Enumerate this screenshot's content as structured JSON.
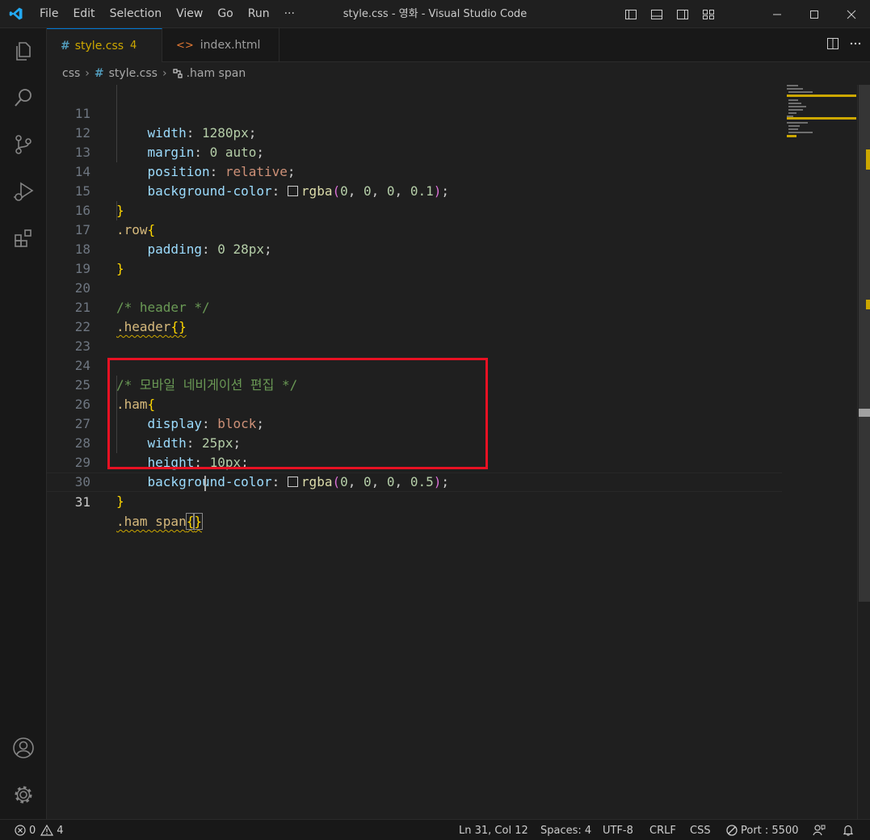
{
  "colors": {
    "accent": "#0078d4",
    "warning": "#cca700",
    "highlight_box": "#e81123"
  },
  "titlebar": {
    "title": "style.css - 영화 - Visual Studio Code",
    "menu": [
      "File",
      "Edit",
      "Selection",
      "View",
      "Go",
      "Run",
      "···"
    ]
  },
  "tabs": [
    {
      "label": "style.css",
      "problems": "4",
      "active": true,
      "icon": "hash-icon"
    },
    {
      "label": "index.html",
      "active": false,
      "icon": "html-code-icon"
    }
  ],
  "breadcrumb": {
    "folder": "css",
    "file": "style.css",
    "symbol": ".ham span"
  },
  "editor": {
    "lines": {
      "l11": "11",
      "l12": "12",
      "l13": "13",
      "l14": "14",
      "l15": "15",
      "l16": "16",
      "l17": "17",
      "l18": "18",
      "l19": "19",
      "l20": "20",
      "l21": "21",
      "l22": "22",
      "l23": "23",
      "l24": "24",
      "l25": "25",
      "l26": "26",
      "l27": "27",
      "l28": "28",
      "l29": "29",
      "l30": "30",
      "l31": "31"
    },
    "code": {
      "width_prop": "width",
      "width_val": "1280px",
      "margin_prop": "margin",
      "margin_val": "0 auto",
      "position_prop": "position",
      "position_val": "relative",
      "bg_prop": "background-color",
      "rgba": "rgba",
      "zero": "0",
      "a01": "0.1",
      "row_sel": ".row",
      "padding_prop": "padding",
      "padding_val": "0 28px",
      "comment_header": "/* header */",
      "header_sel": ".header",
      "comment_mobile": "/* 모바일 네비게이션 편집 */",
      "ham_sel": ".ham",
      "display_prop": "display",
      "display_val": "block",
      "ham_width_val": "25px",
      "height_prop": "height",
      "height_val": "10px",
      "a05": "0.5",
      "ham_span_sel": ".ham span"
    }
  },
  "statusbar": {
    "errors": "0",
    "warnings": "4",
    "position": "Ln 31, Col 12",
    "spaces": "Spaces: 4",
    "encoding": "UTF-8",
    "eol": "CRLF",
    "language": "CSS",
    "port": "Port : 5500"
  }
}
